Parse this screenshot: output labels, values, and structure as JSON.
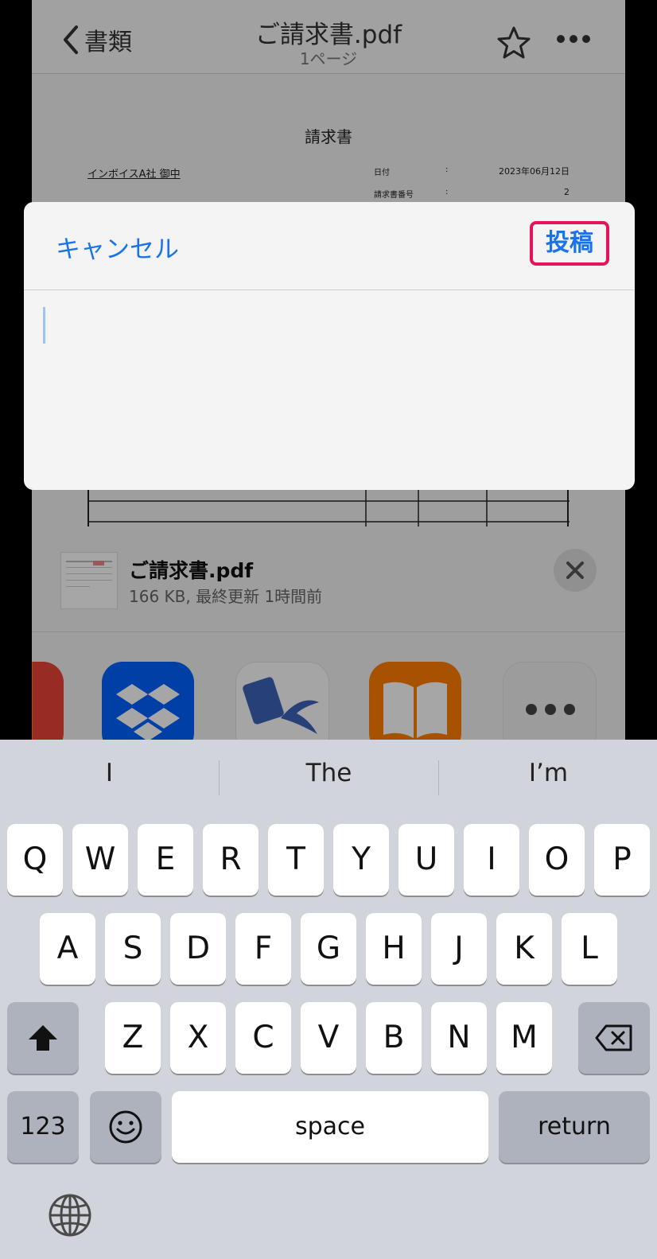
{
  "nav": {
    "back_label": "書類",
    "title": "ご請求書.pdf",
    "subtitle": "1ページ",
    "icons": [
      "chevron-left-icon",
      "star-icon",
      "ellipsis-icon"
    ]
  },
  "document": {
    "title": "請求書",
    "client": "インボイスA社 御中",
    "rows": [
      {
        "label": "日付",
        "colon": ":",
        "value": "2023年06月12日"
      },
      {
        "label": "請求書番号",
        "colon": ":",
        "value": "2"
      }
    ]
  },
  "attachment": {
    "name": "ご請求書.pdf",
    "meta": "166 KB, 最終更新 1時間前"
  },
  "share_apps": [
    "google-drive-icon",
    "dropbox-icon",
    "calculator-app-icon",
    "books-icon",
    "more-icon"
  ],
  "compose": {
    "cancel_label": "キャンセル",
    "post_label": "投稿",
    "highlight_color": "#e8125a",
    "accent_color": "#1a73e8",
    "text": ""
  },
  "keyboard": {
    "suggestions": [
      "I",
      "The",
      "I’m"
    ],
    "row1": [
      "Q",
      "W",
      "E",
      "R",
      "T",
      "Y",
      "U",
      "I",
      "O",
      "P"
    ],
    "row2": [
      "A",
      "S",
      "D",
      "F",
      "G",
      "H",
      "J",
      "K",
      "L"
    ],
    "row3": [
      "Z",
      "X",
      "C",
      "V",
      "B",
      "N",
      "M"
    ],
    "numbers_label": "123",
    "space_label": "space",
    "return_label": "return"
  }
}
